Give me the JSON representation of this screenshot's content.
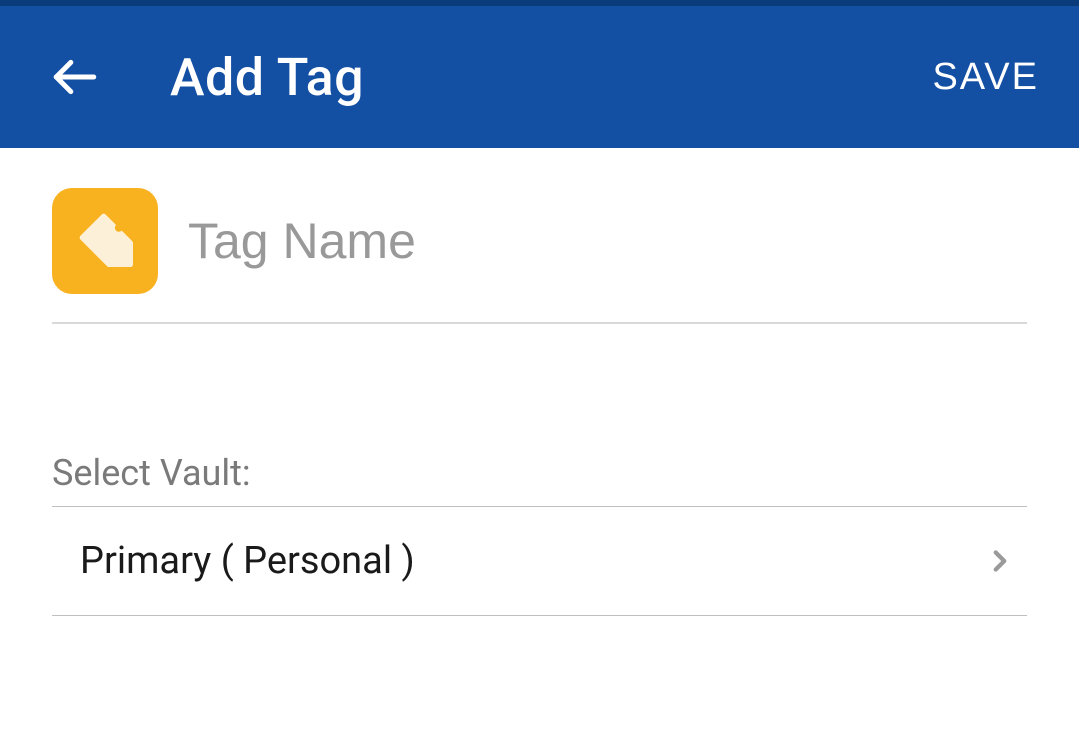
{
  "header": {
    "title": "Add Tag",
    "save_label": "SAVE"
  },
  "form": {
    "tag_name_value": "",
    "tag_name_placeholder": "Tag Name"
  },
  "vault": {
    "label": "Select Vault:",
    "selected": "Primary ( Personal )"
  }
}
